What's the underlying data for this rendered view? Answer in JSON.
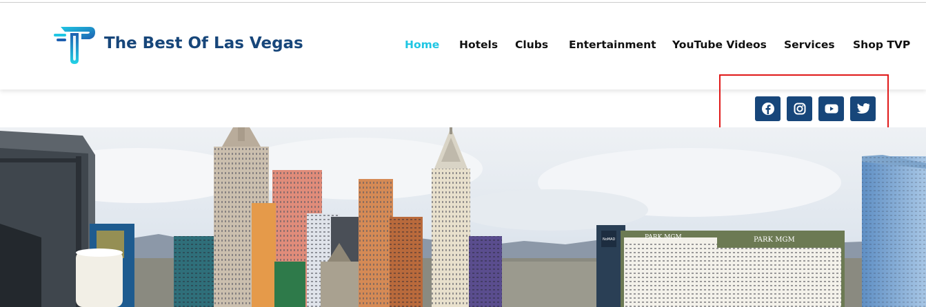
{
  "brand": {
    "title": "The Best Of Las Vegas",
    "logo_icon": "tp-logo-icon",
    "color": "#17467a",
    "accent": "#1fc6e3"
  },
  "nav": {
    "items": [
      {
        "label": "Home",
        "active": true
      },
      {
        "label": "Hotels",
        "active": false
      },
      {
        "label": "Clubs",
        "active": false
      },
      {
        "label": "Entertainment",
        "active": false
      },
      {
        "label": "YouTube Videos",
        "active": false
      },
      {
        "label": "Services",
        "active": false
      },
      {
        "label": "Shop TVP",
        "active": false
      }
    ]
  },
  "social": {
    "icons": [
      "facebook-icon",
      "instagram-icon",
      "youtube-icon",
      "twitter-icon"
    ],
    "highlight_color": "#e01818"
  },
  "hero": {
    "signs": {
      "park_mgm_1": "PARK MGM",
      "park_mgm_2": "PARK MGM",
      "nomad": "NoMAD"
    }
  }
}
